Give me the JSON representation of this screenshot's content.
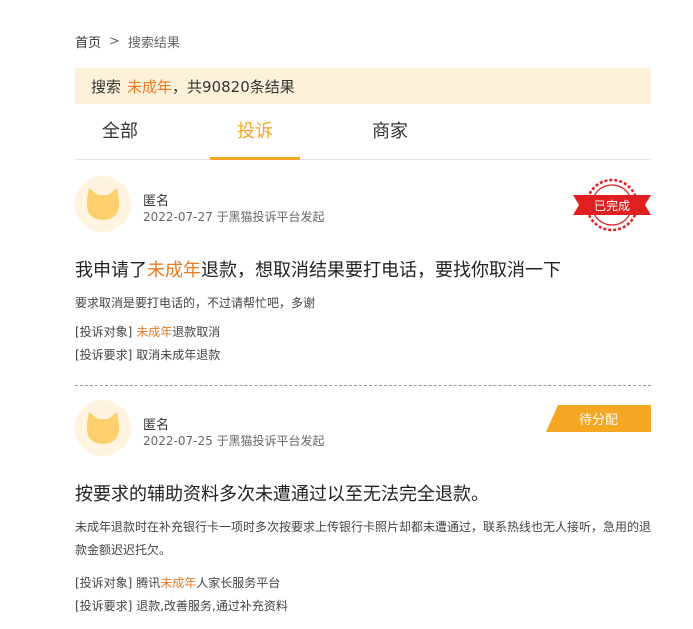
{
  "breadcrumb": {
    "home": "首页",
    "separator": ">",
    "current": "搜索结果"
  },
  "search": {
    "prefix": "搜索",
    "keyword": "未成年",
    "suffix": "，共90820条结果"
  },
  "tabs": [
    {
      "label": "全部",
      "active": false
    },
    {
      "label": "投诉",
      "active": true
    },
    {
      "label": "商家",
      "active": false
    }
  ],
  "colors": {
    "accent": "#f5a623",
    "highlight": "#ec7a20",
    "banner_bg": "#fdf1da",
    "done_red": "#e02020"
  },
  "complaints": [
    {
      "author": "匿名",
      "meta": "2022-07-27 于黑猫投诉平台发起",
      "status": "已完成",
      "title_pre": "我申请了",
      "title_kw": "未成年",
      "title_post": "退款，想取消结果要打电话，要找你取消一下",
      "desc": "要求取消是要打电话的，不过请帮忙吧，多谢",
      "target_label": "[投诉对象]",
      "target_pre": "",
      "target_kw": "未成年",
      "target_post": "退款取消",
      "demand_label": "[投诉要求]",
      "demand": "取消未成年退款"
    },
    {
      "author": "匿名",
      "meta": "2022-07-25 于黑猫投诉平台发起",
      "status": "待分配",
      "title": "按要求的辅助资料多次未遭通过以至无法完全退款。",
      "desc": "未成年退款时在补充银行卡一项时多次按要求上传银行卡照片却都未遭通过，联系热线也无人接听，急用的退款金额迟迟托欠。",
      "target_label": "[投诉对象]",
      "target_pre": "腾讯",
      "target_kw": "未成年",
      "target_post": "人家长服务平台",
      "demand_label": "[投诉要求]",
      "demand": "退款,改善服务,通过补充资料"
    }
  ]
}
